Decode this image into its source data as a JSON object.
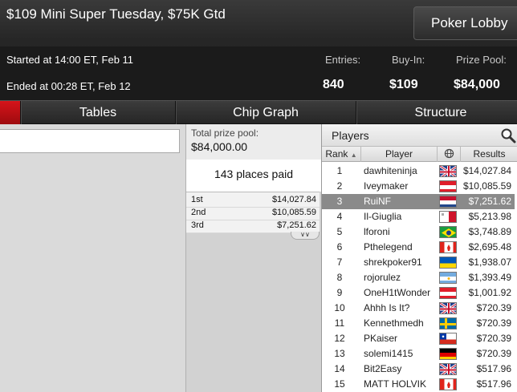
{
  "header": {
    "title": "$109 Mini Super Tuesday, $75K Gtd",
    "lobby_button": "Poker Lobby",
    "started": "Started at 14:00 ET, Feb 11",
    "ended": "Ended at 00:28 ET, Feb 12",
    "entries_label": "Entries:",
    "entries_value": "840",
    "buyin_label": "Buy-In:",
    "buyin_value": "$109",
    "prizepool_label": "Prize Pool:",
    "prizepool_value": "$84,000"
  },
  "tabs": [
    "Tables",
    "Chip Graph",
    "Structure"
  ],
  "prize_panel": {
    "total_label": "Total prize pool:",
    "total_value": "$84,000.00",
    "places_paid": "143 places paid",
    "payouts": [
      {
        "place": "1st",
        "amount": "$14,027.84"
      },
      {
        "place": "2nd",
        "amount": "$10,085.59"
      },
      {
        "place": "3rd",
        "amount": "$7,251.62"
      }
    ]
  },
  "players_panel": {
    "title": "Players",
    "columns": {
      "rank": "Rank",
      "player": "Player",
      "results": "Results"
    },
    "selected_row": 2,
    "rows": [
      {
        "rank": "1",
        "player": "dawhiteninja",
        "flag": "uk",
        "result": "$14,027.84"
      },
      {
        "rank": "2",
        "player": "Iveymaker",
        "flag": "austria",
        "result": "$10,085.59"
      },
      {
        "rank": "3",
        "player": "RuiNF",
        "flag": "netherlands",
        "result": "$7,251.62"
      },
      {
        "rank": "4",
        "player": "Il-Giuglia",
        "flag": "malta",
        "result": "$5,213.98"
      },
      {
        "rank": "5",
        "player": "lforoni",
        "flag": "brazil",
        "result": "$3,748.89"
      },
      {
        "rank": "6",
        "player": "Pthelegend",
        "flag": "canada",
        "result": "$2,695.48"
      },
      {
        "rank": "7",
        "player": "shrekpoker91",
        "flag": "ukraine",
        "result": "$1,938.07"
      },
      {
        "rank": "8",
        "player": "rojorulez",
        "flag": "argentina",
        "result": "$1,393.49"
      },
      {
        "rank": "9",
        "player": "OneH1tWonder",
        "flag": "austria",
        "result": "$1,001.92"
      },
      {
        "rank": "10",
        "player": "Ahhh Is It?",
        "flag": "uk",
        "result": "$720.39"
      },
      {
        "rank": "11",
        "player": "Kennethmedh",
        "flag": "sweden",
        "result": "$720.39"
      },
      {
        "rank": "12",
        "player": "PKaiser",
        "flag": "chile",
        "result": "$720.39"
      },
      {
        "rank": "13",
        "player": "solemi1415",
        "flag": "germany",
        "result": "$720.39"
      },
      {
        "rank": "14",
        "player": "Bit2Easy",
        "flag": "uk",
        "result": "$517.96"
      },
      {
        "rank": "15",
        "player": "MATT HOLVIK",
        "flag": "canada",
        "result": "$517.96"
      }
    ]
  },
  "icons": {
    "search": "search-icon",
    "globe": "globe-icon",
    "sort": "sort-arrow-icon",
    "expand": "chevron-double-down-icon"
  },
  "colors": {
    "accent_red": "#c8101a",
    "selected_row": "#8a8a8a",
    "header_bg": "#1b1b1b"
  }
}
